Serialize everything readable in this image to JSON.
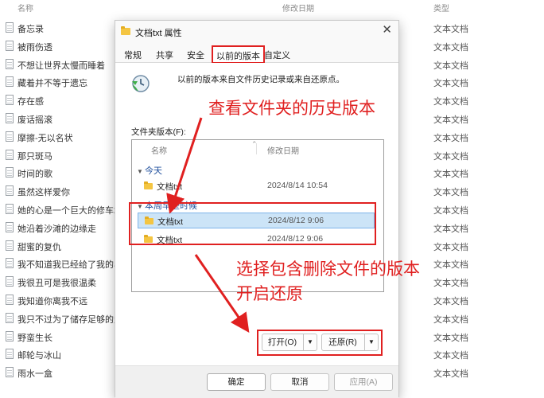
{
  "explorer": {
    "columns": {
      "name": "名称",
      "modified": "修改日期",
      "type": "类型"
    },
    "files": [
      {
        "name": "备忘录",
        "type": "文本文档"
      },
      {
        "name": "被雨伤透",
        "type": "文本文档"
      },
      {
        "name": "不想让世界太慢而睡着",
        "type": "文本文档"
      },
      {
        "name": "藏着并不等于遗忘",
        "type": "文本文档"
      },
      {
        "name": "存在感",
        "type": "文本文档"
      },
      {
        "name": "废话摇滚",
        "type": "文本文档"
      },
      {
        "name": "摩擦-无以名状",
        "type": "文本文档"
      },
      {
        "name": "那只斑马",
        "type": "文本文档"
      },
      {
        "name": "时间的歌",
        "type": "文本文档"
      },
      {
        "name": "虽然这样爱你",
        "type": "文本文档"
      },
      {
        "name": "她的心是一个巨大的修车场",
        "type": "文本文档"
      },
      {
        "name": "她沿着沙滩的边缘走",
        "type": "文本文档"
      },
      {
        "name": "甜蜜的复仇",
        "type": "文本文档"
      },
      {
        "name": "我不知道我已经给了我的早...",
        "type": "文本文档"
      },
      {
        "name": "我很丑可是我很温柔",
        "type": "文本文档"
      },
      {
        "name": "我知道你离我不远",
        "type": "文本文档"
      },
      {
        "name": "我只不过为了储存足够的爱",
        "type": "文本文档"
      },
      {
        "name": "野蛮生长",
        "type": "文本文档"
      },
      {
        "name": "邮轮与冰山",
        "type": "文本文档"
      },
      {
        "name": "雨水一盒",
        "type": "文本文档"
      }
    ]
  },
  "dialog": {
    "title": "文档txt 属性",
    "tabs": [
      "常规",
      "共享",
      "安全",
      "以前的版本",
      "自定义"
    ],
    "active_tab": "以前的版本",
    "description": "以前的版本来自文件历史记录或来自还原点。",
    "versions_label": "文件夹版本(F):",
    "columns": {
      "name": "名称",
      "date": "修改日期"
    },
    "groups": [
      {
        "label": "今天",
        "items": [
          {
            "name": "文档txt",
            "date": "2024/8/14 10:54",
            "selected": false
          }
        ]
      },
      {
        "label": "本周早些时候",
        "items": [
          {
            "name": "文档txt",
            "date": "2024/8/12 9:06",
            "selected": true
          },
          {
            "name": "文档txt",
            "date": "2024/8/12 9:06",
            "selected": false
          }
        ]
      }
    ],
    "buttons": {
      "open": "打开(O)",
      "restore": "还原(R)",
      "ok": "确定",
      "cancel": "取消",
      "apply": "应用(A)"
    }
  },
  "annotations": {
    "top": "查看文件夹的历史版本",
    "bottom_line1": "选择包含删除文件的版本",
    "bottom_line2": "开启还原"
  },
  "colors": {
    "annotation": "#e02020",
    "selection": "#cce4f7",
    "group_text": "#1e4e9c"
  }
}
